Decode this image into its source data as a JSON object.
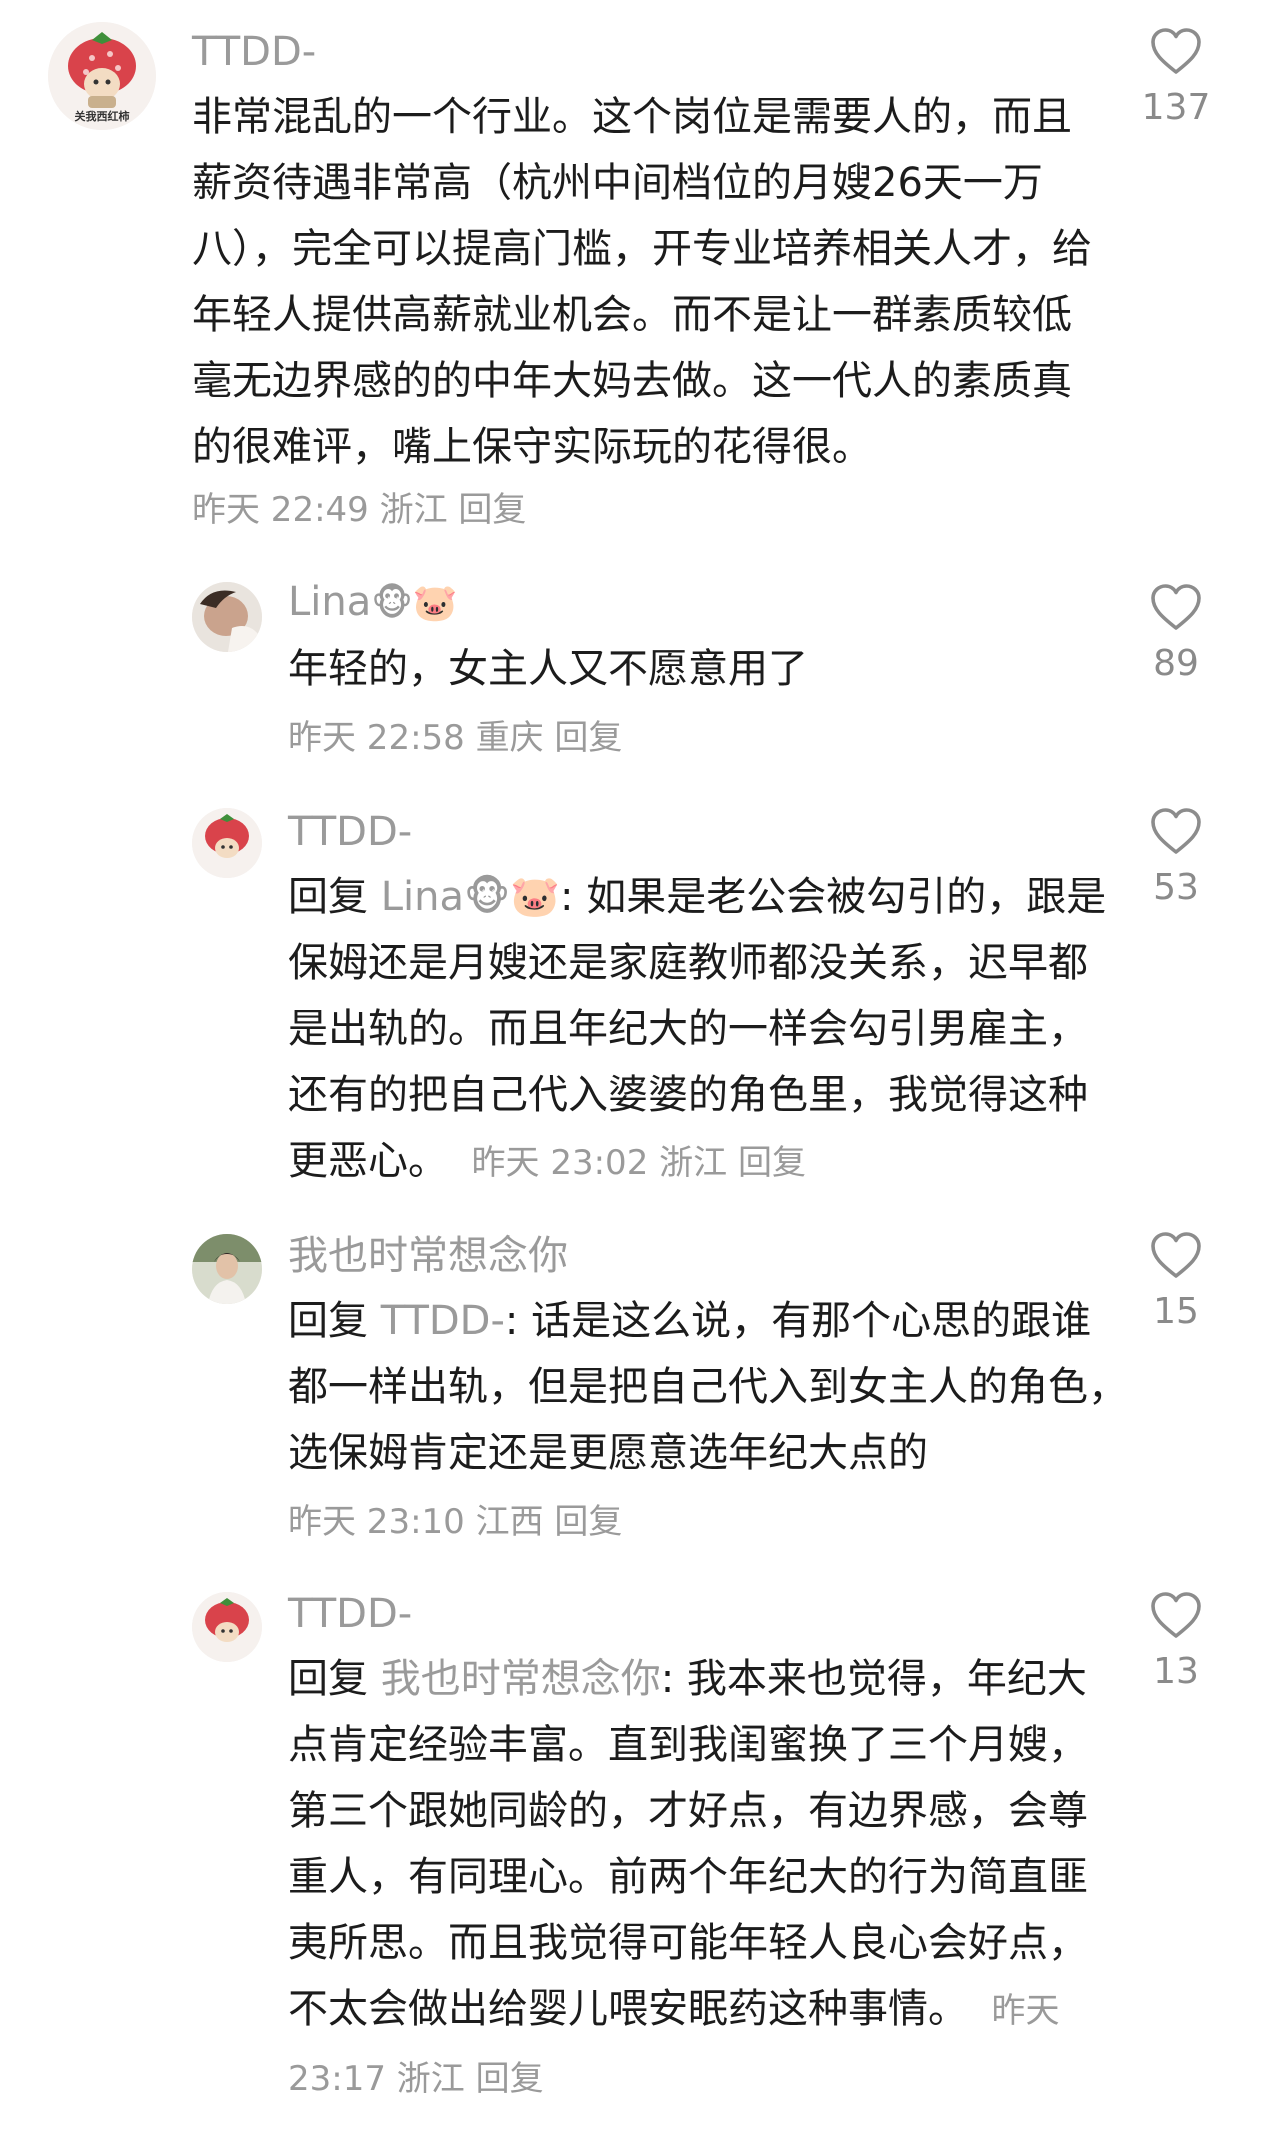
{
  "comments": [
    {
      "username": "TTDD-",
      "avatar_text": "关我西红柿",
      "text": "非常混乱的一个行业。这个岗位是需要人的，而且薪资待遇非常高（杭州中间档位的月嫂26天一万八），完全可以提高门槛，开专业培养相关人才，给年轻人提供高薪就业机会。而不是让一群素质较低毫无边界感的的中年大妈去做。这一代人的素质真的很难评，嘴上保守实际玩的花得很。",
      "time": "昨天 22:49",
      "location": "浙江",
      "reply_label": "回复",
      "likes": "137"
    },
    {
      "username": "Lina",
      "emojis": "🐵🐷",
      "text": "年轻的，女主人又不愿意用了",
      "time": "昨天 22:58",
      "location": "重庆",
      "reply_label": "回复",
      "likes": "89"
    },
    {
      "username": "TTDD-",
      "avatar_text": "关我西红柿",
      "reply_prefix": "回复 ",
      "reply_to": "Lina🐵🐷",
      "text": ": 如果是老公会被勾引的，跟是保姆还是月嫂还是家庭教师都没关系，迟早都是出轨的。而且年纪大的一样会勾引男雇主，还有的把自己代入婆婆的角色里，我觉得这种更恶心。",
      "time": "昨天 23:02",
      "location": "浙江",
      "reply_label": "回复",
      "likes": "53"
    },
    {
      "username": "我也时常想念你",
      "reply_prefix": "回复 ",
      "reply_to": "TTDD-",
      "text": ": 话是这么说，有那个心思的跟谁都一样出轨，但是把自己代入到女主人的角色，选保姆肯定还是更愿意选年纪大点的",
      "time": "昨天 23:10",
      "location": "江西",
      "reply_label": "回复",
      "likes": "15"
    },
    {
      "username": "TTDD-",
      "avatar_text": "关我西红柿",
      "reply_prefix": "回复 ",
      "reply_to": "我也时常想念你",
      "text": ": 我本来也觉得，年纪大点肯定经验丰富。直到我闺蜜换了三个月嫂，第三个跟她同龄的，才好点，有边界感，会尊重人，有同理心。前两个年纪大的行为简直匪夷所思。而且我觉得可能年轻人良心会好点，不太会做出给婴儿喂安眠药这种事情。",
      "time": "昨天 23:17",
      "location": "浙江",
      "reply_label": "回复",
      "likes": "13"
    }
  ]
}
